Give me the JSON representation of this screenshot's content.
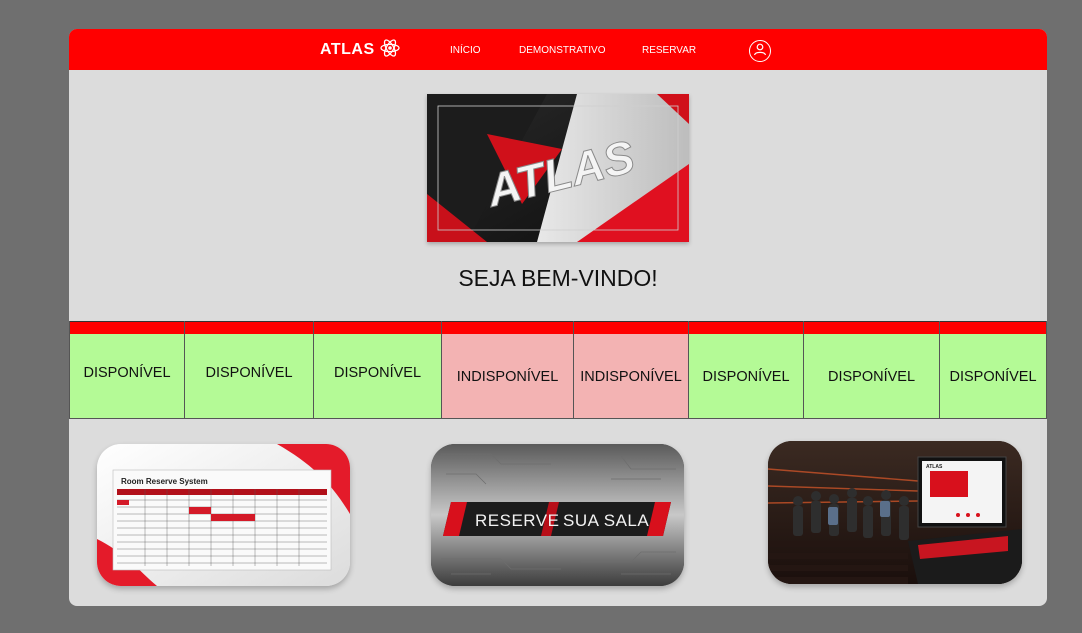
{
  "navbar": {
    "brand": "ATLAS",
    "links": [
      "INÍCIO",
      "DEMONSTRATIVO",
      "RESERVAR"
    ],
    "bg_color": "#ff0000"
  },
  "hero": {
    "logo_text": "ATLAS",
    "welcome": "SEJA BEM-VINDO!"
  },
  "rooms": [
    {
      "status": "DISPONÍVEL",
      "available": true
    },
    {
      "status": "DISPONÍVEL",
      "available": true
    },
    {
      "status": "DISPONÍVEL",
      "available": true
    },
    {
      "status": "INDISPONÍVEL",
      "available": false
    },
    {
      "status": "INDISPONÍVEL",
      "available": false
    },
    {
      "status": "DISPONÍVEL",
      "available": true
    },
    {
      "status": "DISPONÍVEL",
      "available": true
    },
    {
      "status": "DISPONÍVEL",
      "available": true
    }
  ],
  "cards": [
    {
      "title": "Room Reserve System"
    },
    {
      "title_a": "RESERVE",
      "title_b": "SUA SALA"
    },
    {
      "screen_text": "ATLAS"
    }
  ],
  "colors": {
    "accent": "#ff0000",
    "available": "#b4fa96",
    "unavailable": "#f3b3b3",
    "page_bg": "#dcdcdc",
    "backdrop": "#6f6f6f"
  }
}
